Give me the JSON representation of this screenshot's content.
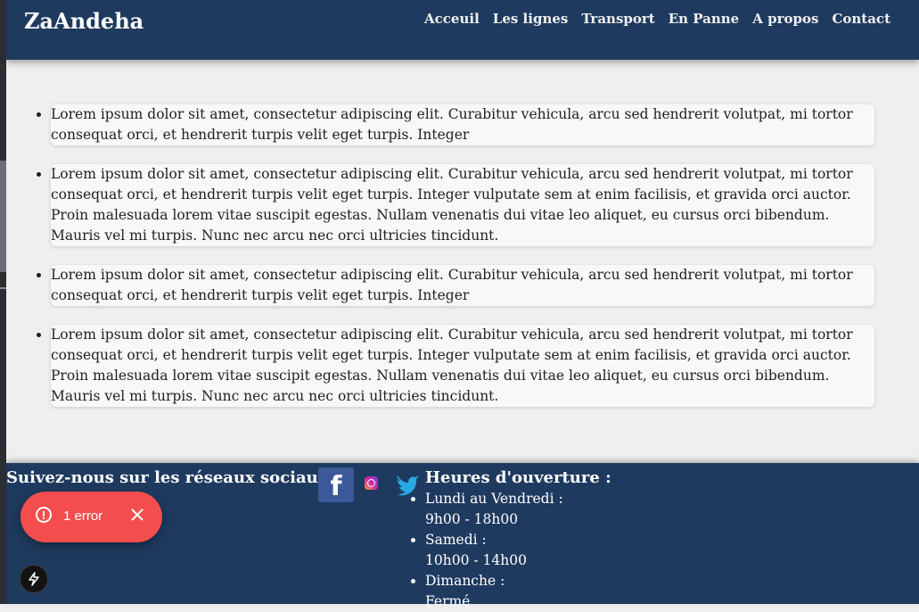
{
  "header": {
    "brand": "ZaAndeha",
    "nav": [
      "Acceuil",
      "Les lignes",
      "Transport",
      "En Panne",
      "A propos",
      "Contact"
    ]
  },
  "main": {
    "posts": [
      "Lorem ipsum dolor sit amet, consectetur adipiscing elit. Curabitur vehicula, arcu sed hendrerit volutpat, mi tortor consequat orci, et hendrerit turpis velit eget turpis. Integer",
      "Lorem ipsum dolor sit amet, consectetur adipiscing elit. Curabitur vehicula, arcu sed hendrerit volutpat, mi tortor consequat orci, et hendrerit turpis velit eget turpis. Integer vulputate sem at enim facilisis, et gravida orci auctor. Proin malesuada lorem vitae suscipit egestas. Nullam venenatis dui vitae leo aliquet, eu cursus orci bibendum. Mauris vel mi turpis. Nunc nec arcu nec orci ultricies tincidunt.",
      "Lorem ipsum dolor sit amet, consectetur adipiscing elit. Curabitur vehicula, arcu sed hendrerit volutpat, mi tortor consequat orci, et hendrerit turpis velit eget turpis. Integer",
      "Lorem ipsum dolor sit amet, consectetur adipiscing elit. Curabitur vehicula, arcu sed hendrerit volutpat, mi tortor consequat orci, et hendrerit turpis velit eget turpis. Integer vulputate sem at enim facilisis, et gravida orci auctor. Proin malesuada lorem vitae suscipit egestas. Nullam venenatis dui vitae leo aliquet, eu cursus orci bibendum. Mauris vel mi turpis. Nunc nec arcu nec orci ultricies tincidunt."
    ]
  },
  "footer": {
    "follow_label": "Suivez-nous sur les réseaux sociaux :",
    "social_icons": [
      "facebook-icon",
      "instagram-icon",
      "twitter-icon"
    ],
    "hours_title": "Heures d'ouverture :",
    "hours": [
      {
        "day": "Lundi au Vendredi :",
        "time": "9h00 - 18h00"
      },
      {
        "day": "Samedi :",
        "time": "10h00 - 14h00"
      },
      {
        "day": "Dimanche :",
        "time": "Fermé"
      }
    ]
  },
  "dev_overlay": {
    "error_count_label": "1 error",
    "icons": [
      "alert-circle-icon",
      "close-icon",
      "lightning-icon"
    ]
  },
  "colors": {
    "header_bg": "#1f3a5f",
    "page_bg": "#efefef",
    "card_bg": "#f8f8f8",
    "toast_bg": "#f44d4d",
    "facebook": "#3b5998"
  }
}
